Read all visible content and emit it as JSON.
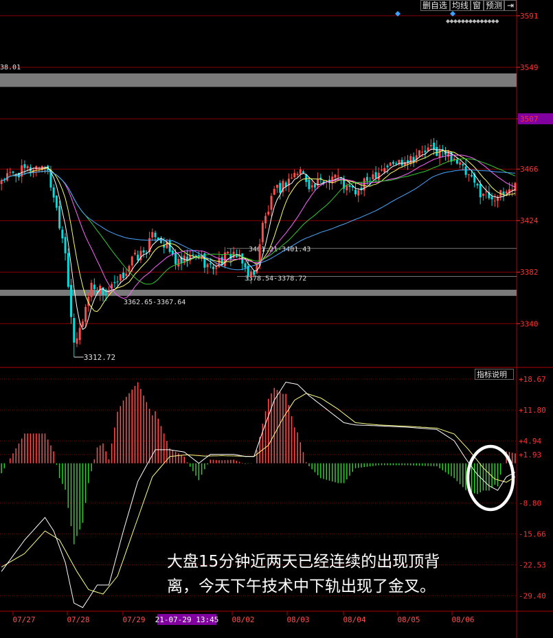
{
  "toolbar": {
    "self_select": "删自选",
    "ma_lines": "均线",
    "window": "窗",
    "forecast": "预测",
    "pin": "⇥"
  },
  "indicator_button": "指标说明",
  "caption": {
    "line1": "大盘15分钟近两天已经连续的出现顶背",
    "line2": "离，今天下午技术中下轨出现了金叉。"
  },
  "colors": {
    "background": "#000000",
    "up": "#ff4d4d",
    "down": "#00e0e0",
    "hist_up": "#ff5050",
    "hist_down": "#33cc33",
    "price_axis": "#ff3030",
    "ma5": "#ffffff",
    "ma10": "#ffff66",
    "ma20": "#ff66ff",
    "ma30": "#33cc33",
    "ma60": "#4aa8ff",
    "grid": "#8b0000",
    "gap_band": "#7a7a7a",
    "highlight_price": "#8000a0",
    "cursor_label": "#8000a0"
  },
  "chart_data": [
    {
      "type": "candlestick",
      "interval": "15min",
      "x_ticks": [
        "07/27",
        "07/28",
        "07/29",
        "08/02",
        "08/03",
        "08/04",
        "08/05",
        "08/06"
      ],
      "cursor_label": "21-07-29 13:45",
      "y_ticks": [
        3591,
        3549,
        3507,
        3466,
        3424,
        3382,
        3340
      ],
      "ylim": [
        3306,
        3596
      ],
      "highlighted_price": 3507,
      "gap_zones": [
        {
          "label": "38.01",
          "low": 3533,
          "high": 3544
        },
        {
          "label": "3362.65-3367.64",
          "low": 3362.65,
          "high": 3367.64
        }
      ],
      "level_lines": [
        {
          "label": "3401.21-3401.43",
          "value": 3401.3
        },
        {
          "label": "3378.54-3378.72",
          "value": 3378.6
        }
      ],
      "low_annotation": {
        "label": "3312.72",
        "value": 3312.72
      },
      "close_keypoints": [
        [
          0,
          3458
        ],
        [
          8,
          3465
        ],
        [
          15,
          3470
        ],
        [
          18,
          3445
        ],
        [
          22,
          3400
        ],
        [
          25,
          3320
        ],
        [
          27,
          3335
        ],
        [
          31,
          3372
        ],
        [
          36,
          3365
        ],
        [
          40,
          3372
        ],
        [
          45,
          3392
        ],
        [
          49,
          3398
        ],
        [
          53,
          3414
        ],
        [
          57,
          3402
        ],
        [
          61,
          3388
        ],
        [
          64,
          3392
        ],
        [
          68,
          3396
        ],
        [
          72,
          3385
        ],
        [
          76,
          3392
        ],
        [
          80,
          3398
        ],
        [
          84,
          3385
        ],
        [
          87,
          3378
        ],
        [
          90,
          3420
        ],
        [
          94,
          3446
        ],
        [
          99,
          3458
        ],
        [
          103,
          3465
        ],
        [
          107,
          3451
        ],
        [
          111,
          3456
        ],
        [
          115,
          3462
        ],
        [
          119,
          3450
        ],
        [
          123,
          3447
        ],
        [
          127,
          3460
        ],
        [
          131,
          3467
        ],
        [
          135,
          3470
        ],
        [
          139,
          3474
        ],
        [
          143,
          3478
        ],
        [
          148,
          3482
        ],
        [
          152,
          3479
        ],
        [
          156,
          3476
        ],
        [
          159,
          3465
        ],
        [
          162,
          3456
        ],
        [
          165,
          3448
        ],
        [
          168,
          3444
        ],
        [
          172,
          3444
        ],
        [
          175,
          3450
        ],
        [
          177,
          3453
        ]
      ]
    },
    {
      "type": "macd",
      "y_ticks": [
        18.67,
        11.8,
        4.94,
        1.93,
        -8.8,
        -15.66,
        -22.53,
        -29.4
      ],
      "ylim": [
        -32.5,
        20.5
      ],
      "dif_keypoints": [
        [
          0,
          -24
        ],
        [
          8,
          -17
        ],
        [
          15,
          -12
        ],
        [
          18,
          -15
        ],
        [
          22,
          -22
        ],
        [
          25,
          -31
        ],
        [
          28,
          -32
        ],
        [
          33,
          -27
        ],
        [
          37,
          -27
        ],
        [
          42,
          -15
        ],
        [
          47,
          -4
        ],
        [
          53,
          3
        ],
        [
          58,
          3
        ],
        [
          63,
          2.5
        ],
        [
          68,
          0
        ],
        [
          72,
          2
        ],
        [
          76,
          2
        ],
        [
          80,
          2
        ],
        [
          84,
          1.5
        ],
        [
          87,
          1.5
        ],
        [
          90,
          7
        ],
        [
          94,
          14
        ],
        [
          98,
          18
        ],
        [
          102,
          17.5
        ],
        [
          106,
          15
        ],
        [
          110,
          13
        ],
        [
          114,
          11
        ],
        [
          118,
          9
        ],
        [
          122,
          8.5
        ],
        [
          130,
          8.3
        ],
        [
          140,
          8
        ],
        [
          150,
          7.5
        ],
        [
          156,
          5
        ],
        [
          160,
          1
        ],
        [
          164,
          -2.5
        ],
        [
          168,
          -5
        ],
        [
          171,
          -6
        ],
        [
          174,
          -3
        ],
        [
          177,
          -2
        ]
      ],
      "dea_keypoints": [
        [
          0,
          -23
        ],
        [
          8,
          -20
        ],
        [
          15,
          -15
        ],
        [
          20,
          -17
        ],
        [
          26,
          -24
        ],
        [
          30,
          -28
        ],
        [
          35,
          -29
        ],
        [
          40,
          -25
        ],
        [
          46,
          -14
        ],
        [
          52,
          -3
        ],
        [
          58,
          1.5
        ],
        [
          64,
          1.9
        ],
        [
          70,
          1.6
        ],
        [
          76,
          1.7
        ],
        [
          82,
          1.6
        ],
        [
          87,
          1.5
        ],
        [
          92,
          4
        ],
        [
          97,
          10
        ],
        [
          101,
          14
        ],
        [
          105,
          15.5
        ],
        [
          110,
          14.5
        ],
        [
          116,
          12
        ],
        [
          122,
          9
        ],
        [
          130,
          8.5
        ],
        [
          140,
          8.2
        ],
        [
          150,
          7.8
        ],
        [
          156,
          6.5
        ],
        [
          161,
          3
        ],
        [
          166,
          -1
        ],
        [
          170,
          -3.5
        ],
        [
          174,
          -4.2
        ],
        [
          177,
          -3
        ]
      ]
    }
  ]
}
